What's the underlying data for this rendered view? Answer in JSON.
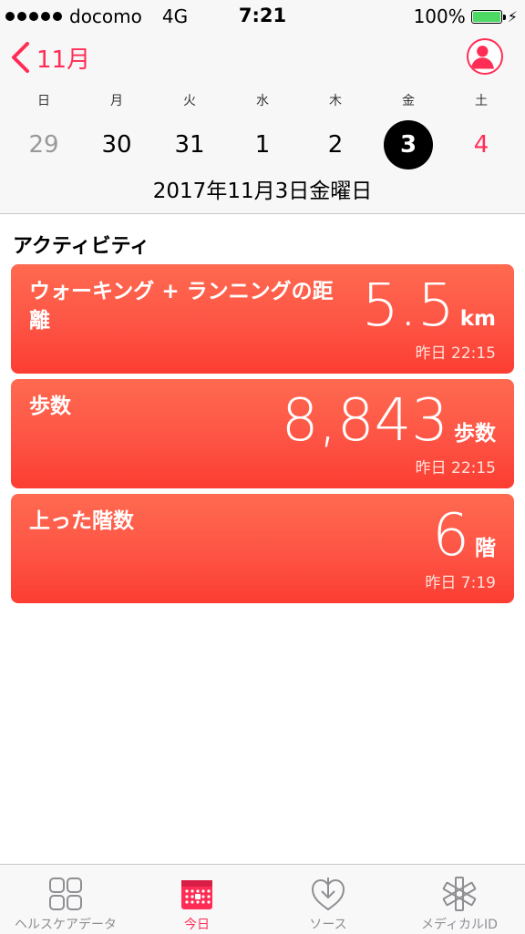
{
  "status_bar": {
    "carrier": "docomo",
    "network": "4G",
    "time": "7:21",
    "battery": "100%"
  },
  "header": {
    "back_label": "11月"
  },
  "calendar": {
    "weekdays": [
      "日",
      "月",
      "火",
      "水",
      "木",
      "金",
      "土"
    ],
    "dates": [
      "29",
      "30",
      "31",
      "1",
      "2",
      "3",
      "4"
    ],
    "selected_index": 5,
    "title": "2017年11月3日金曜日"
  },
  "section": {
    "title": "アクティビティ"
  },
  "cards": [
    {
      "title": "ウォーキング + ランニングの距離",
      "value": "5.5",
      "unit": "km",
      "time": "昨日 22:15"
    },
    {
      "title": "歩数",
      "value": "8,843",
      "unit": "歩数",
      "time": "昨日 22:15"
    },
    {
      "title": "上った階数",
      "value": "6",
      "unit": "階",
      "time": "昨日 7:19"
    }
  ],
  "tabs": [
    {
      "label": "ヘルスケアデータ",
      "icon": "grid-icon"
    },
    {
      "label": "今日",
      "icon": "calendar-icon"
    },
    {
      "label": "ソース",
      "icon": "download-heart-icon"
    },
    {
      "label": "メディカルID",
      "icon": "medical-star-icon"
    }
  ],
  "colors": {
    "accent": "#ff2d55",
    "card": "#fd5445",
    "battery": "#4cd964"
  }
}
